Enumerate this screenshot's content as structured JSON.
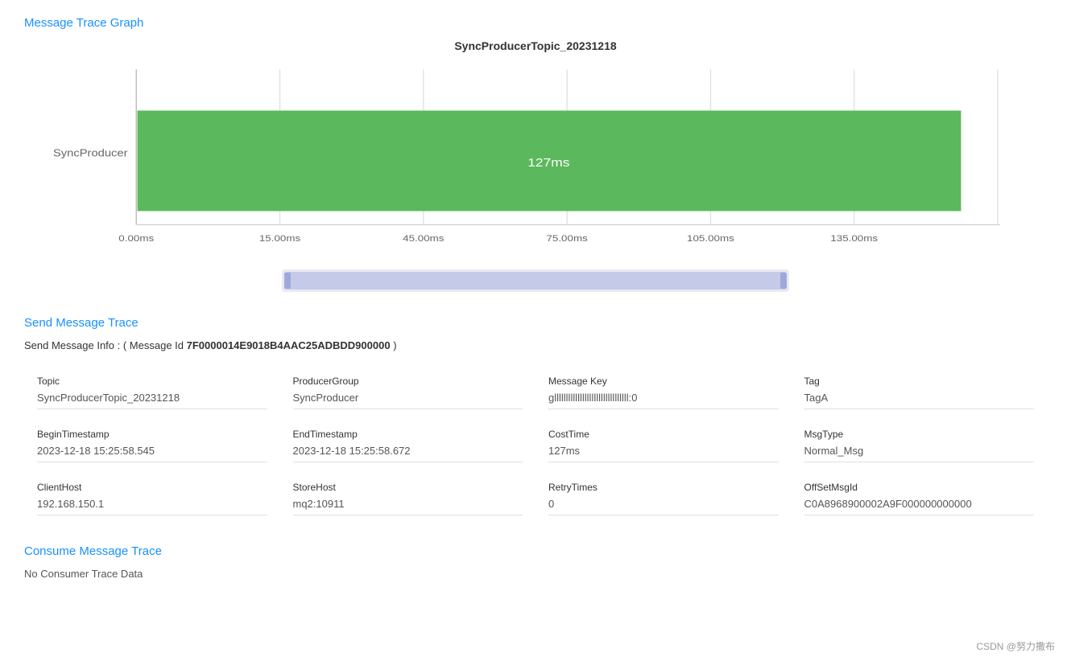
{
  "page": {
    "title": "Message Trace Graph"
  },
  "chart": {
    "title": "SyncProducerTopic_20231218",
    "y_label": "SyncProducer",
    "bar_label": "127ms",
    "bar_color": "#5cb85c",
    "x_ticks": [
      "0.00ms",
      "15.00ms",
      "45.00ms",
      "75.00ms",
      "105.00ms",
      "135.00ms"
    ],
    "bar_start_pct": 0,
    "bar_width_pct": 0.94
  },
  "send_trace": {
    "section_title": "Send Message Trace",
    "info_prefix": "Send Message Info : ( Message Id",
    "message_id": "7F0000014E9018B4AAC25ADBDD900000",
    "info_suffix": ")",
    "fields": [
      {
        "label": "Topic",
        "value": "SyncProducerTopic_20231218"
      },
      {
        "label": "ProducerGroup",
        "value": "SyncProducer"
      },
      {
        "label": "Message Key",
        "value": "gllllllllllllllllllllllllllllllll:0"
      },
      {
        "label": "Tag",
        "value": "TagA"
      },
      {
        "label": "BeginTimestamp",
        "value": "2023-12-18 15:25:58.545"
      },
      {
        "label": "EndTimestamp",
        "value": "2023-12-18 15:25:58.672"
      },
      {
        "label": "CostTime",
        "value": "127ms"
      },
      {
        "label": "MsgType",
        "value": "Normal_Msg"
      },
      {
        "label": "ClientHost",
        "value": "192.168.150.1"
      },
      {
        "label": "StoreHost",
        "value": "mq2:10911"
      },
      {
        "label": "RetryTimes",
        "value": "0"
      },
      {
        "label": "OffSetMsgId",
        "value": "C0A8968900002A9F000000000000"
      }
    ]
  },
  "consume_trace": {
    "section_title": "Consume Message Trace",
    "no_data_text": "No Consumer Trace Data"
  },
  "footer": {
    "text": "CSDN @努力撒布"
  }
}
